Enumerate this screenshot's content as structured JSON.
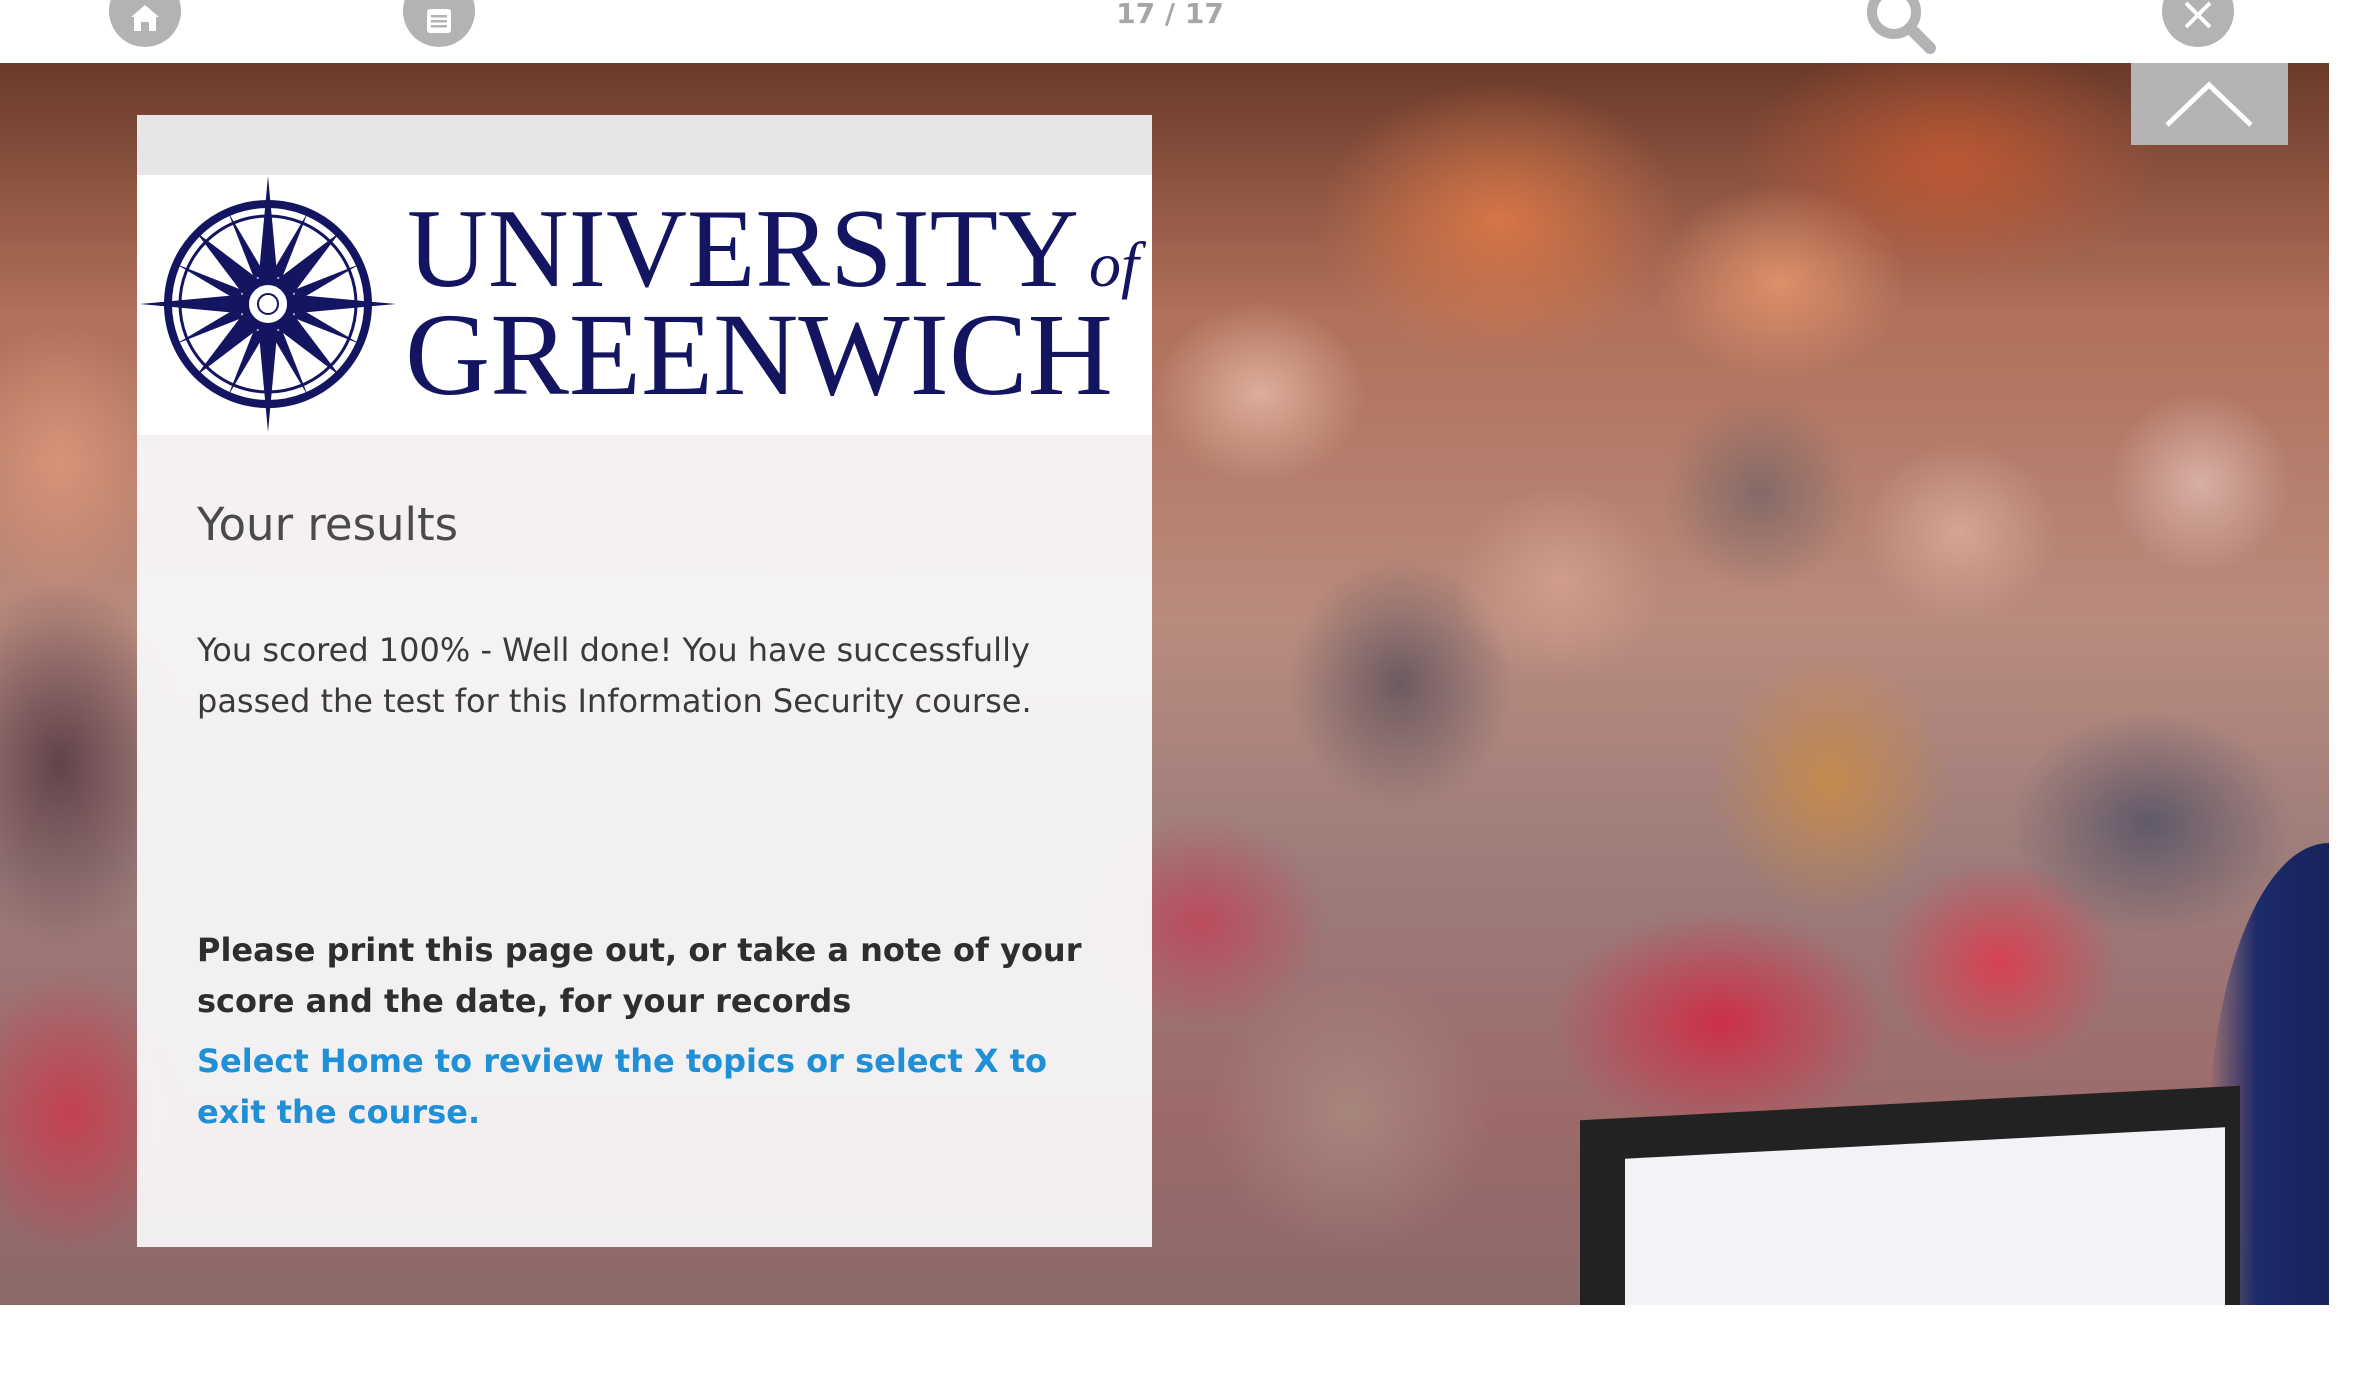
{
  "toolbar": {
    "page_counter": "17 / 17",
    "home_icon": "home-icon",
    "menu_icon": "list-icon",
    "search_icon": "search-icon",
    "close_icon": "close-icon",
    "icon_color": "#b3b3b3"
  },
  "stage": {
    "scroll_top_icon": "chevron-up-icon",
    "background": "blurred photo of a lecture audience with presenter and laptop"
  },
  "logo": {
    "line1": "UNIVERSITY",
    "of": "of",
    "line2": "GREENWICH",
    "brand_color": "#141561"
  },
  "card": {
    "heading": "Your results",
    "score_text": "You scored 100% - Well done! You have successfully passed the test for this Information Security course.",
    "print_note": "Please print this page out, or take a note of your score and the date, for your records",
    "home_link": "Select Home to review the topics or select X to exit the course.",
    "link_color": "#1f8fd6"
  }
}
